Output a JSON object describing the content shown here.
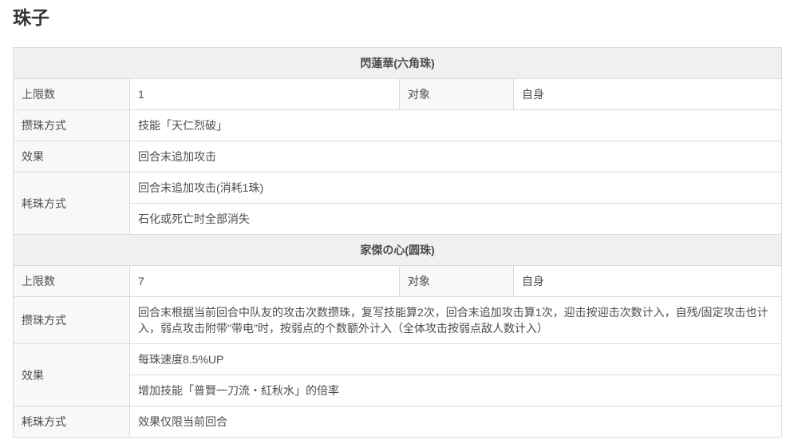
{
  "page": {
    "title": "珠子"
  },
  "colors": {
    "section_header_bg": "#eef0f2",
    "label_cell_bg": "#f8f8f9",
    "border": "#d9dbdd",
    "body_text": "#4d4d4d",
    "title_text": "#333333"
  },
  "table": {
    "sections": [
      {
        "header": "閃蓮華(六角珠)",
        "limit_label": "上限数",
        "limit_value": "1",
        "target_label": "对象",
        "target_value": "自身",
        "gain_label": "攒珠方式",
        "gain_values": [
          "技能「天仁烈破」"
        ],
        "effect_label": "效果",
        "effect_values": [
          "回合末追加攻击"
        ],
        "consume_label": "耗珠方式",
        "consume_values": [
          "回合末追加攻击(消耗1珠)",
          "石化或死亡时全部消失"
        ]
      },
      {
        "header": "家傑の心(圆珠)",
        "limit_label": "上限数",
        "limit_value": "7",
        "target_label": "对象",
        "target_value": "自身",
        "gain_label": "攒珠方式",
        "gain_values": [
          "回合末根据当前回合中队友的攻击次数攒珠，复写技能算2次，回合末追加攻击算1次，迎击按迎击次数计入，自残/固定攻击也计入，弱点攻击附带\"带电\"时，按弱点的个数额外计入（全体攻击按弱点敌人数计入）"
        ],
        "effect_label": "效果",
        "effect_values": [
          "每珠速度8.5%UP",
          "增加技能「普賢一刀流・紅秋水」的倍率"
        ],
        "consume_label": "耗珠方式",
        "consume_values": [
          "效果仅限当前回合"
        ]
      }
    ]
  }
}
